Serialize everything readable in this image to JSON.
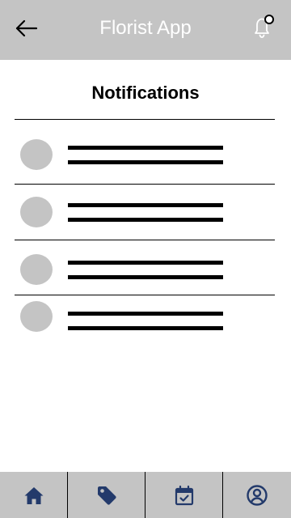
{
  "header": {
    "title": "Florist App",
    "back_icon": "arrow-left-icon",
    "bell_icon": "bell-icon",
    "background": "#c4c4c4"
  },
  "page": {
    "title": "Notifications"
  },
  "notifications": [
    {
      "avatar": "placeholder-circle"
    },
    {
      "avatar": "placeholder-circle"
    },
    {
      "avatar": "placeholder-circle"
    },
    {
      "avatar": "placeholder-circle"
    }
  ],
  "bottom_nav": {
    "items": [
      {
        "icon": "home-icon"
      },
      {
        "icon": "tag-icon"
      },
      {
        "icon": "calendar-check-icon"
      },
      {
        "icon": "user-circle-icon"
      }
    ],
    "icon_color": "#233a6b"
  }
}
